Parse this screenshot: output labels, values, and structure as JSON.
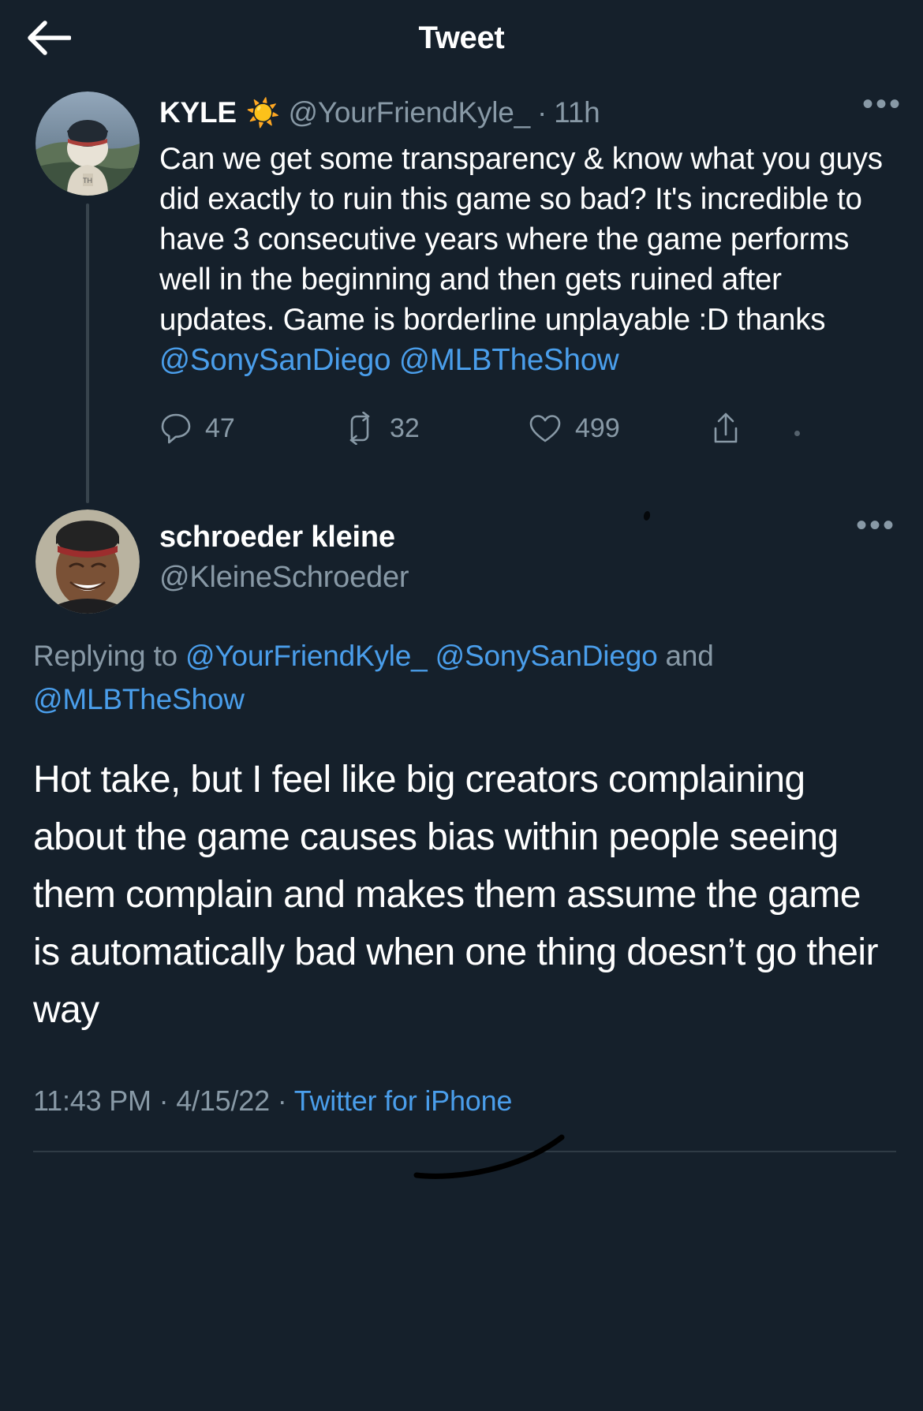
{
  "header": {
    "title": "Tweet",
    "back_icon": "back-arrow-icon"
  },
  "parent_tweet": {
    "display_name": "KYLE",
    "emoji": "☀️",
    "handle": "@YourFriendKyle_",
    "separator": "·",
    "timestamp": "11h",
    "more_icon": "•••",
    "text_parts": [
      {
        "type": "text",
        "value": "Can we get some transparency & know what you guys did exactly to ruin this game so bad? It's incredible to have 3 consecutive years where the game performs well in the beginning and then gets ruined after updates. Game is borderline unplayable :D thanks "
      },
      {
        "type": "mention",
        "value": "@SonySanDiego"
      },
      {
        "type": "text",
        "value": " "
      },
      {
        "type": "mention",
        "value": "@MLBTheShow"
      }
    ],
    "actions": {
      "reply_count": "47",
      "retweet_count": "32",
      "like_count": "499",
      "reply_icon": "reply-bubble-icon",
      "retweet_icon": "retweet-icon",
      "like_icon": "heart-icon",
      "share_icon": "share-icon"
    }
  },
  "reply_tweet": {
    "display_name": "schroeder kleine",
    "handle": "@KleineSchroeder",
    "more_icon": "•••",
    "replying_to_label": "Replying to ",
    "replying_to_mentions": [
      "@YourFriendKyle_",
      "@SonySanDiego"
    ],
    "replying_to_conjunction": " and ",
    "replying_to_last": "@MLBTheShow",
    "body": "Hot take, but I feel like big creators complaining about the game causes bias within people seeing them complain and makes them assume the game is automatically bad when one thing doesn’t go their way",
    "time": "11:43 PM",
    "meta_separator_1": " · ",
    "date": "4/15/22",
    "meta_separator_2": " · ",
    "source": "Twitter for iPhone"
  },
  "colors": {
    "background": "#15202b",
    "text": "#ffffff",
    "muted": "#8899a6",
    "link": "#4a9eeb",
    "divider": "#2f3b45"
  }
}
